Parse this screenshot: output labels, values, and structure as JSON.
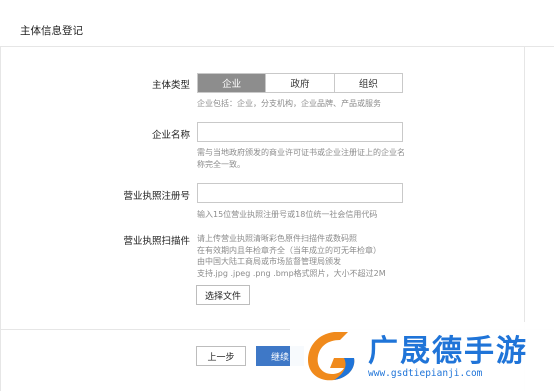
{
  "page": {
    "title": "主体信息登记"
  },
  "subject_type": {
    "label": "主体类型",
    "options": [
      "企业",
      "政府",
      "组织"
    ],
    "selected": "企业",
    "hint": "企业包括：企业，分支机构，企业品牌、产品或服务"
  },
  "company_name": {
    "label": "企业名称",
    "value": "",
    "hint_lines": [
      "需与当地政府颁发的商业许可证书或企业注册证上的企业名",
      "称完全一致。"
    ]
  },
  "license_number": {
    "label": "营业执照注册号",
    "value": "",
    "hint": "输入15位营业执照注册号或18位统一社会信用代码"
  },
  "license_scan": {
    "label": "营业执照扫描件",
    "hint_lines": [
      "请上传营业执照清晰彩色原件扫描件或数码照",
      "在有效期内且年检章齐全（当年成立的可无年检章）",
      "由中国大陆工商局或市场监督管理局颁发",
      "支持.jpg .jpeg .png .bmp格式照片，大小不超过2M"
    ],
    "button": "选择文件"
  },
  "footer": {
    "prev": "上一步",
    "next": "继续"
  },
  "watermark": {
    "title": "广晟德手游",
    "url": "www.gsdtiepianji.com",
    "color": "#1f74d8"
  },
  "colors": {
    "accent": "#3e78c7",
    "segment_active": "#8d8d8d"
  }
}
